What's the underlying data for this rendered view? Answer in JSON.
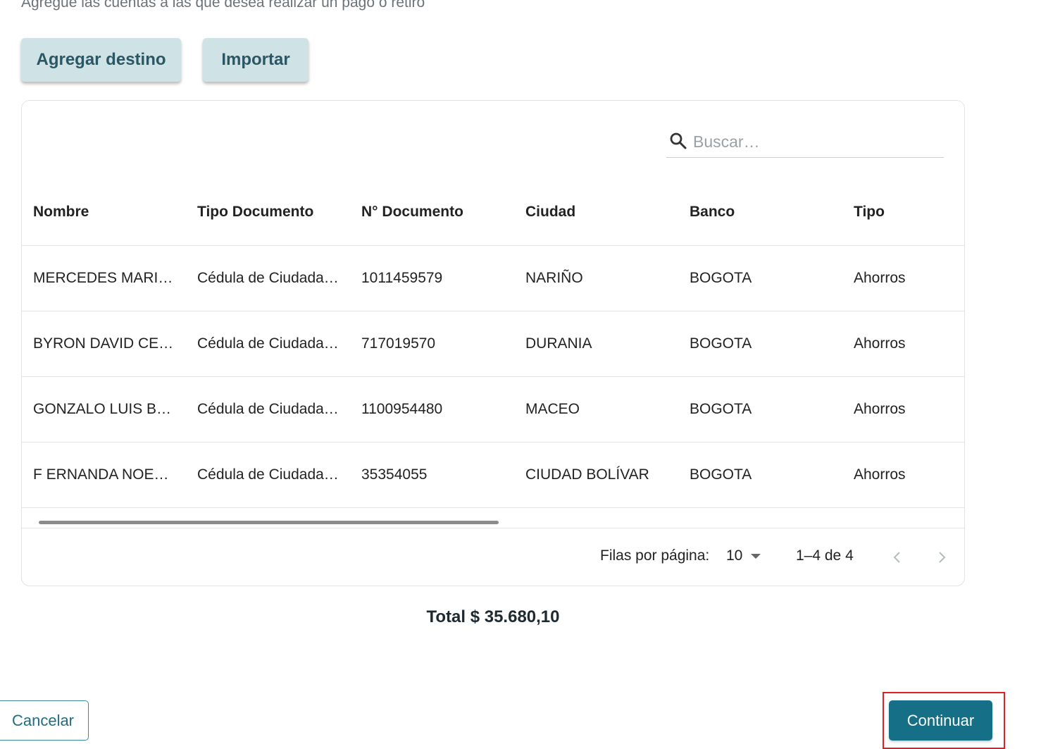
{
  "subtitle": "Agregue las cuentas a las que desea realizar un pago o retiro",
  "toolbar": {
    "add_label": "Agregar destino",
    "import_label": "Importar"
  },
  "search": {
    "placeholder": "Buscar…",
    "icon": "search-icon"
  },
  "table": {
    "columns": [
      "Nombre",
      "Tipo Documento",
      "N° Documento",
      "Ciudad",
      "Banco",
      "Tipo"
    ],
    "rows": [
      [
        "MERCEDES MARI…",
        "Cédula de Ciudada…",
        "1011459579",
        "NARIÑO",
        "BOGOTA",
        "Ahorros"
      ],
      [
        "BYRON DAVID CE…",
        "Cédula de Ciudada…",
        "717019570",
        "DURANIA",
        "BOGOTA",
        "Ahorros"
      ],
      [
        "GONZALO LUIS B…",
        "Cédula de Ciudada…",
        "1100954480",
        "MACEO",
        "BOGOTA",
        "Ahorros"
      ],
      [
        "F ERNANDA NOE…",
        "Cédula de Ciudada…",
        "35354055",
        "CIUDAD BOLÍVAR",
        "BOGOTA",
        "Ahorros"
      ]
    ]
  },
  "pagination": {
    "rows_per_page_label": "Filas por página:",
    "rows_per_page_value": "10",
    "range": "1–4 de 4"
  },
  "total": "Total $ 35.680,10",
  "actions": {
    "cancel_label": "Cancelar",
    "continue_label": "Continuar"
  },
  "colors": {
    "primary": "#156f86",
    "secondary_button_bg": "#cfe2e6",
    "highlight": "#e02020"
  }
}
